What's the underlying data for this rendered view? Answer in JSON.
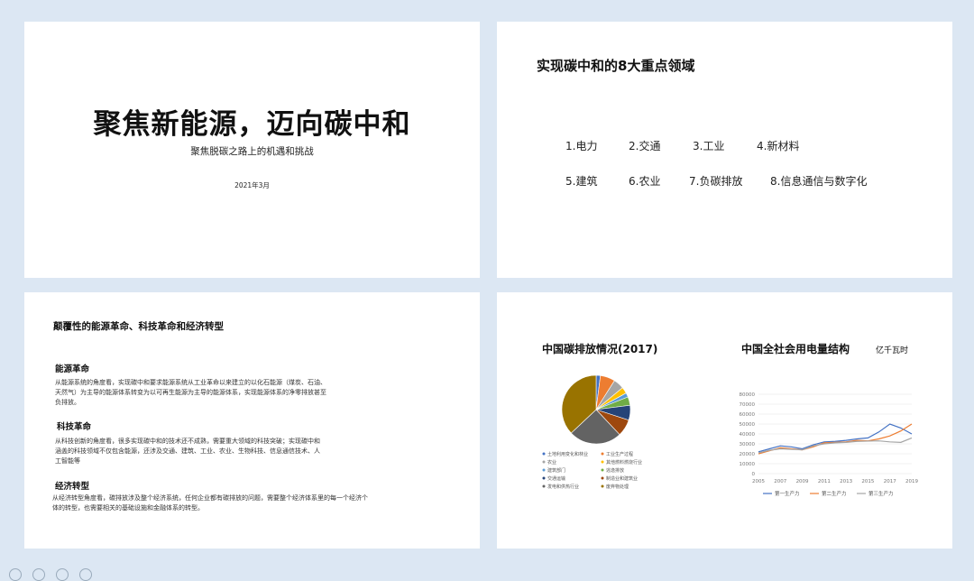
{
  "slide1": {
    "title": "聚焦新能源，迈向碳中和",
    "subtitle": "聚焦脱碳之路上的机遇和挑战",
    "date": "2021年3月"
  },
  "slide2": {
    "title": "实现碳中和的8大重点领域",
    "areas": [
      "1.电力",
      "2.交通",
      "3.工业",
      "4.新材料",
      "5.建筑",
      "6.农业",
      "7.负碳排放",
      "8.信息通信与数字化"
    ]
  },
  "slide3": {
    "title": "颠覆性的能源革命、科技革命和经济转型",
    "sections": [
      {
        "heading": "能源革命",
        "lines": [
          "从能源系统的角度看，实现碳中和要求能源系统从工业革命以来建立的以化石能源（煤炭、石油、",
          "天然气）为主导的能源体系转变为以可再生能源为主导的能源体系，实现能源体系的净零排放甚至",
          "负排放。"
        ]
      },
      {
        "heading": "科技革命",
        "lines": [
          "从科技创新的角度看，很多实现碳中和的技术还不成熟，需要重大领域的科技突破；实现碳中和",
          "涵盖的科技领域不仅包含能源，还涉及交通、建筑、工业、农业、生物科技、信息通信技术、人",
          "工智能等"
        ]
      },
      {
        "heading": "经济转型",
        "lines": [
          "从经济转型角度看，碳排放涉及整个经济系统，任何企业都有碳排放的问题，需要整个经济体系里的每一个经济个",
          "体的转型，也需要相关的基础设施和金融体系的转型。"
        ]
      }
    ]
  },
  "slide4": {
    "pie_title": "中国碳排放情况(2017)",
    "line_title": "中国全社会用电量结构",
    "unit": "亿千瓦时"
  },
  "chart_data": [
    {
      "type": "pie",
      "title": "中国碳排放情况(2017)",
      "legend": [
        "土地利用变化和林业",
        "工业生产过程",
        "农业",
        "其他燃料燃烧行业",
        "建筑部门",
        "逃逸排放",
        "交通运输",
        "制造业和建筑业",
        "发电和供热行业",
        "废弃物处理"
      ],
      "values": [
        2,
        7,
        5,
        3,
        2,
        4,
        7,
        8,
        25,
        37
      ],
      "colors": [
        "#4472c4",
        "#ed7d31",
        "#a5a5a5",
        "#ffc000",
        "#5b9bd5",
        "#70ad47",
        "#264478",
        "#9e480e",
        "#636363",
        "#997300"
      ]
    },
    {
      "type": "line",
      "title": "中国全社会用电量结构",
      "ylabel": "亿千瓦时",
      "x": [
        "2005",
        "2006",
        "2007",
        "2008",
        "2009",
        "2010",
        "2011",
        "2012",
        "2013",
        "2014",
        "2015",
        "2016",
        "2017",
        "2018",
        "2019"
      ],
      "xticks": [
        "2005",
        "2007",
        "2009",
        "2011",
        "2013",
        "2015",
        "2017",
        "2019"
      ],
      "ylim": [
        0,
        80000
      ],
      "yticks": [
        0,
        10000,
        20000,
        30000,
        40000,
        50000,
        60000,
        70000,
        80000
      ],
      "series": [
        {
          "name": "第一生产力",
          "color": "#4472c4",
          "values": [
            22000,
            25000,
            28000,
            27000,
            25000,
            29000,
            32000,
            32500,
            33500,
            35000,
            36000,
            42000,
            50000,
            46000,
            40000
          ]
        },
        {
          "name": "第二生产力",
          "color": "#ed7d31",
          "values": [
            20000,
            23000,
            26000,
            25000,
            24000,
            27000,
            31000,
            31500,
            32000,
            33500,
            33000,
            35000,
            38000,
            43000,
            50000
          ]
        },
        {
          "name": "第三生产力",
          "color": "#a5a5a5",
          "values": [
            21000,
            23500,
            25000,
            24500,
            24000,
            28000,
            30000,
            31000,
            31500,
            32500,
            32800,
            33000,
            32000,
            31500,
            36000
          ]
        }
      ]
    }
  ]
}
